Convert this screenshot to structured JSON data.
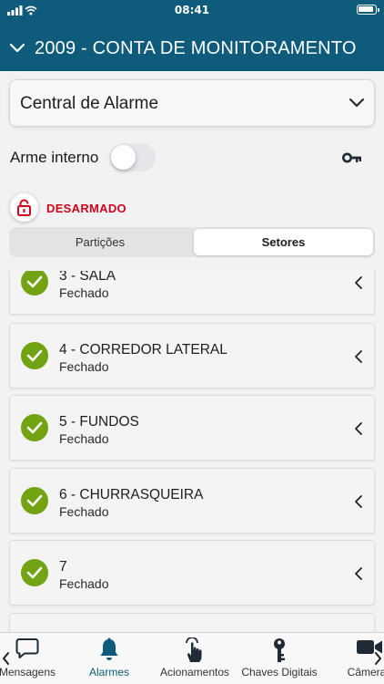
{
  "status_bar": {
    "time": "08:41"
  },
  "header": {
    "title": "2009 - CONTA DE MONITORAMENTO"
  },
  "selector": {
    "value": "Central de Alarme"
  },
  "arme": {
    "label": "Arme interno",
    "enabled": false
  },
  "status": {
    "text": "DESARMADO",
    "color": "#d0021b"
  },
  "segments": [
    {
      "label": "Partições",
      "selected": false
    },
    {
      "label": "Setores",
      "selected": true
    }
  ],
  "sectors": [
    {
      "name": "3 - SALA",
      "state": "Fechado"
    },
    {
      "name": "4 - CORREDOR LATERAL",
      "state": "Fechado"
    },
    {
      "name": "5 - FUNDOS",
      "state": "Fechado"
    },
    {
      "name": "6 - CHURRASQUEIRA",
      "state": "Fechado"
    },
    {
      "name": "7",
      "state": "Fechado"
    }
  ],
  "tabbar": {
    "items": [
      {
        "label": "Mensagens",
        "icon": "chat-bubble-icon"
      },
      {
        "label": "Alarmes",
        "icon": "bell-icon",
        "active": true
      },
      {
        "label": "Acionamentos",
        "icon": "hand-tap-icon"
      },
      {
        "label": "Chaves Digitais",
        "icon": "key-icon"
      },
      {
        "label": "Câmeras",
        "icon": "video-camera-icon"
      }
    ]
  },
  "colors": {
    "header": "#0e5b7c",
    "accent": "#0e5b7c",
    "ok": "#72a312",
    "alarm": "#d0021b"
  }
}
